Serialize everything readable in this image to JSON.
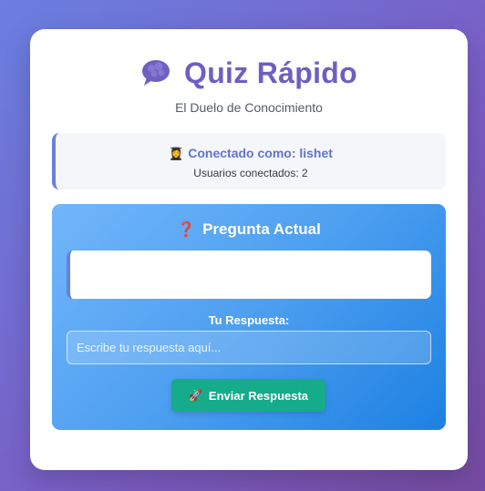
{
  "app": {
    "title": "Quiz Rápido",
    "subtitle": "El Duelo de Conocimiento",
    "title_icon": "brain-icon"
  },
  "status": {
    "icon": "graduate-icon",
    "icon_glyph": "👩‍🎓",
    "connected_label": "Conectado como: lishet",
    "users_connected": "Usuarios conectados: 2"
  },
  "question": {
    "icon": "question-mark-icon",
    "icon_glyph": "❓",
    "heading": "Pregunta Actual",
    "text": ""
  },
  "answer": {
    "label": "Tu Respuesta:",
    "placeholder": "Escribe tu respuesta aquí...",
    "value": ""
  },
  "submit": {
    "icon": "rocket-icon",
    "icon_glyph": "🚀",
    "label": "Enviar Respuesta"
  },
  "colors": {
    "accent": "#6e5fc0",
    "status_text": "#6274cc",
    "panel_start": "#72b6fb",
    "panel_end": "#1d81e2",
    "button": "#16ab8a"
  }
}
